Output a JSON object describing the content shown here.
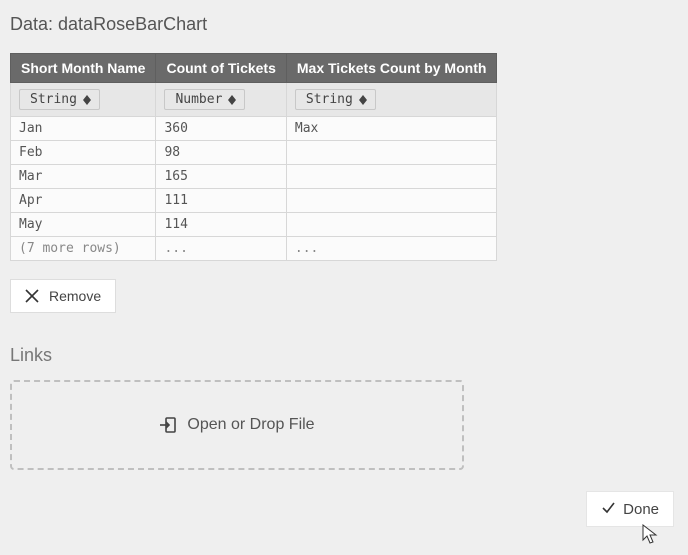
{
  "title_prefix": "Data: ",
  "title_name": "dataRoseBarChart",
  "columns": [
    {
      "header": "Short Month Name",
      "type": "String"
    },
    {
      "header": "Count of Tickets",
      "type": "Number"
    },
    {
      "header": "Max Tickets Count by Month",
      "type": "String"
    }
  ],
  "rows": [
    {
      "c0": "Jan",
      "c1": "360",
      "c2": "Max"
    },
    {
      "c0": "Feb",
      "c1": "98",
      "c2": ""
    },
    {
      "c0": "Mar",
      "c1": "165",
      "c2": ""
    },
    {
      "c0": "Apr",
      "c1": "111",
      "c2": ""
    },
    {
      "c0": "May",
      "c1": "114",
      "c2": ""
    }
  ],
  "more_row": {
    "c0": "(7 more rows)",
    "c1": "...",
    "c2": "..."
  },
  "remove_label": "Remove",
  "links_title": "Links",
  "dropzone_label": "Open or Drop File",
  "done_label": "Done"
}
